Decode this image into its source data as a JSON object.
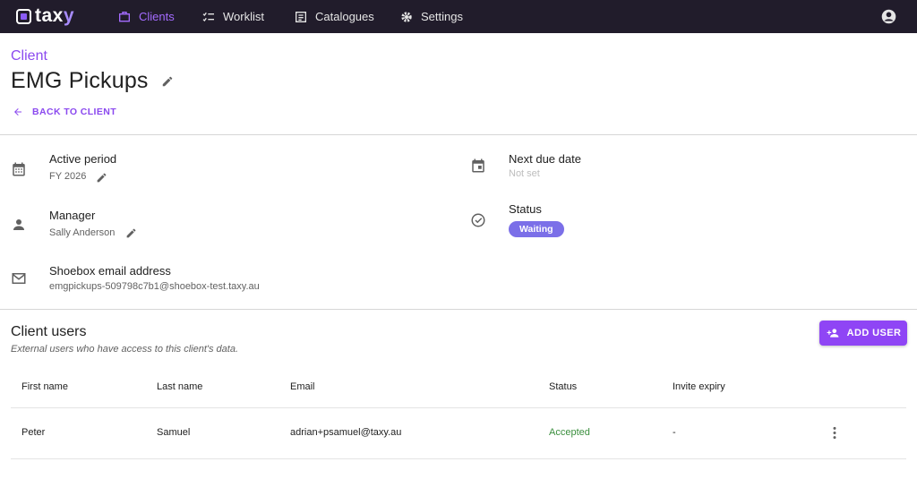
{
  "app": {
    "logo_text": "taxy",
    "nav": [
      {
        "label": "Clients",
        "icon": "briefcase-icon",
        "active": true
      },
      {
        "label": "Worklist",
        "icon": "checklist-icon",
        "active": false
      },
      {
        "label": "Catalogues",
        "icon": "catalogue-icon",
        "active": false
      },
      {
        "label": "Settings",
        "icon": "gear-icon",
        "active": false
      }
    ],
    "account_icon": "account-circle-icon"
  },
  "header": {
    "breadcrumb": "Client",
    "title": "EMG Pickups",
    "back_label": "BACK TO CLIENT"
  },
  "details": {
    "active_period": {
      "label": "Active period",
      "value": "FY 2026",
      "icon": "calendar-icon"
    },
    "manager": {
      "label": "Manager",
      "value": "Sally Anderson",
      "icon": "person-icon"
    },
    "shoebox": {
      "label": "Shoebox email address",
      "value": "emgpickups-509798c7b1@shoebox-test.taxy.au",
      "icon": "mail-icon"
    },
    "next_due": {
      "label": "Next due date",
      "value": "Not set",
      "icon": "event-icon"
    },
    "status": {
      "label": "Status",
      "value": "Waiting",
      "icon": "check-circle-icon"
    }
  },
  "client_users": {
    "title": "Client users",
    "subtitle": "External users who have access to this client's data.",
    "add_label": "ADD USER",
    "columns": [
      "First name",
      "Last name",
      "Email",
      "Status",
      "Invite expiry"
    ],
    "rows": [
      {
        "first": "Peter",
        "last": "Samuel",
        "email": "adrian+psamuel@taxy.au",
        "status": "Accepted",
        "expiry": "-"
      }
    ]
  },
  "colors": {
    "accent": "#8b49ef",
    "topbar": "#211c2b",
    "status_chip": "#7b6fe8",
    "accepted": "#3b8f3e"
  }
}
